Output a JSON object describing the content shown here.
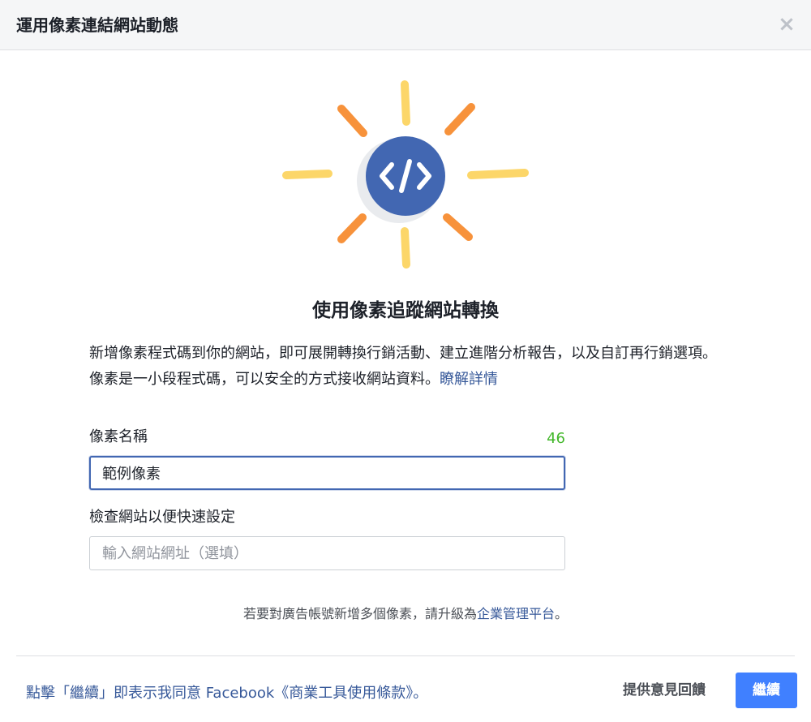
{
  "dialog": {
    "title": "運用像素連結網站動態",
    "close_icon": "close-icon",
    "close_glyph": "×"
  },
  "hero": {
    "icon": "code-icon",
    "colors": {
      "ray_yellow": "#fcd669",
      "ray_orange": "#f7923b",
      "circle": "#4267b2",
      "shadow": "#e9ebee"
    }
  },
  "main": {
    "title": "使用像素追蹤網站轉換",
    "description": "新增像素程式碼到你的網站，即可展開轉換行銷活動、建立進階分析報告，以及自訂再行銷選項。像素是一小段程式碼，可以安全的方式接收網站資料。",
    "learn_more": "瞭解詳情"
  },
  "form": {
    "pixel_name_label": "像素名稱",
    "pixel_name_counter": "46",
    "pixel_name_value": "範例像素",
    "website_label": "檢查網站以便快速設定",
    "website_placeholder": "輸入網站網址（選填）"
  },
  "upgrade": {
    "text_before": "若要對廣告帳號新增多個像素，請升級為",
    "link": "企業管理平台",
    "text_after": "。"
  },
  "footer": {
    "terms": "點擊「繼續」即表示我同意 Facebook《商業工具使用條款》。",
    "feedback": "提供意見回饋",
    "continue": "繼續"
  },
  "colors": {
    "accent": "#4080ff",
    "link": "#365899",
    "counter": "#42b72a"
  }
}
